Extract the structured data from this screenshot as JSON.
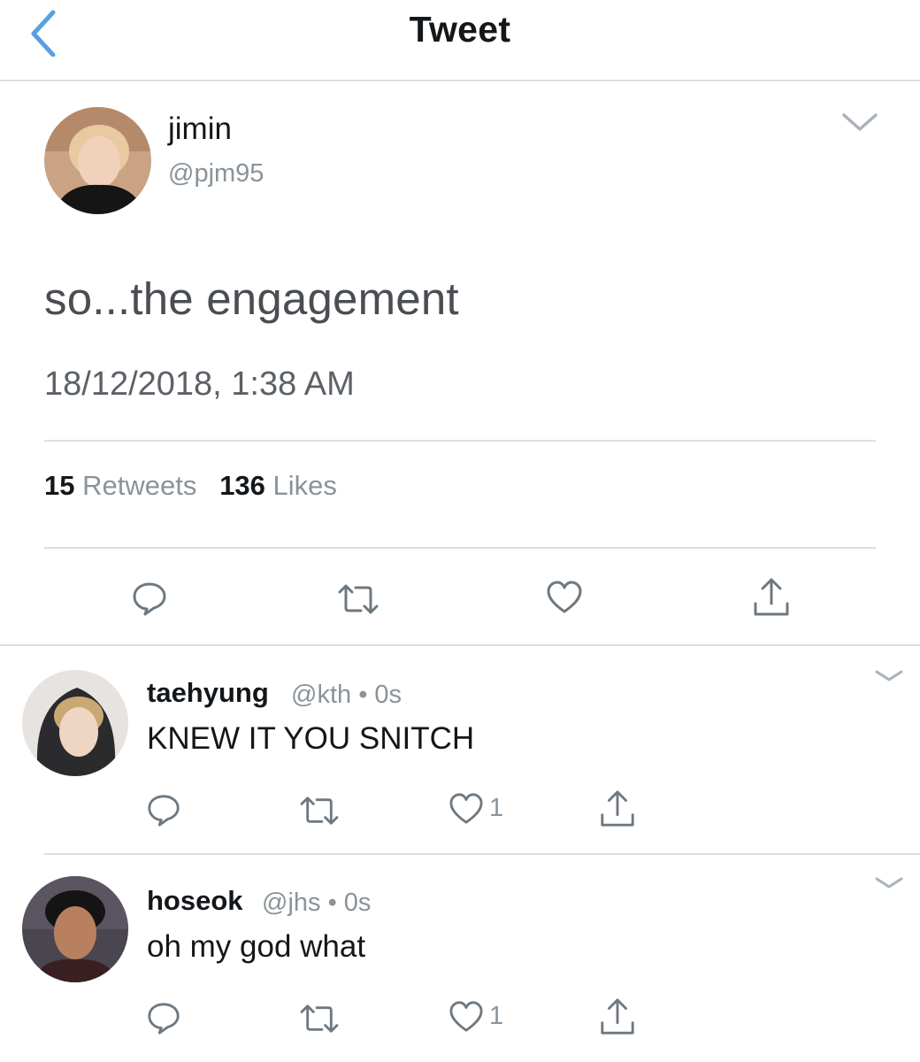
{
  "header": {
    "title": "Tweet",
    "back_icon": "chevron-left-icon",
    "accent": "#5b9fe0"
  },
  "tweet": {
    "name": "jimin",
    "handle": "@pjm95",
    "text": "so...the engagement",
    "timestamp": "18/12/2018, 1:38 AM",
    "retweets_count": "15",
    "retweets_label": "Retweets",
    "likes_count": "136",
    "likes_label": "Likes",
    "actions": [
      "reply-icon",
      "retweet-icon",
      "heart-icon",
      "share-icon"
    ]
  },
  "replies": [
    {
      "name": "taehyung",
      "handle": "@kth",
      "separator": "•",
      "time": "0s",
      "text": "KNEW IT YOU SNITCH",
      "likes": "1"
    },
    {
      "name": "hoseok",
      "handle": "@jhs",
      "separator": "•",
      "time": "0s",
      "text": "oh my god what",
      "likes": "1"
    }
  ]
}
